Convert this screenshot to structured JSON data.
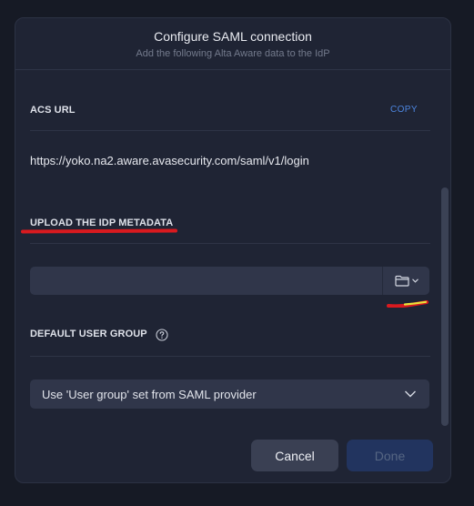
{
  "dialog": {
    "title": "Configure SAML connection",
    "subtitle": "Add the following Alta Aware data to the IdP"
  },
  "acs": {
    "label": "ACS URL",
    "copy_label": "COPY",
    "url": "https://yoko.na2.aware.avasecurity.com/saml/v1/login"
  },
  "upload": {
    "label": "UPLOAD THE IDP METADATA",
    "value": "",
    "button_icon": "folder-icon"
  },
  "user_group": {
    "label": "DEFAULT USER GROUP",
    "help_icon": "question-circle-icon",
    "selected": "Use 'User group' set from SAML provider"
  },
  "footer": {
    "cancel_label": "Cancel",
    "done_label": "Done"
  },
  "colors": {
    "accent": "#4d86e0",
    "annotation_red": "#d91a1f",
    "annotation_yellow": "#e8e23a",
    "dialog_bg": "#1f2434"
  }
}
